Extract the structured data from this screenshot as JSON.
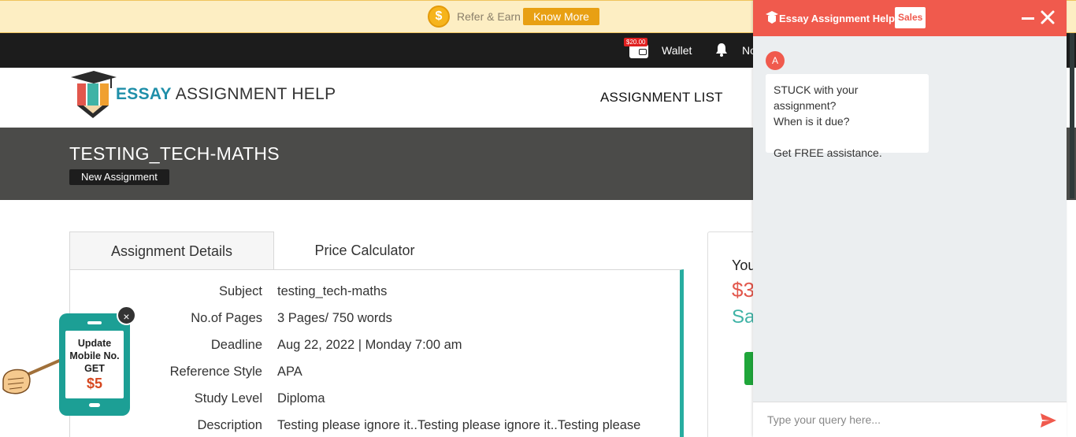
{
  "promo": {
    "coin_symbol": "$",
    "refer_label": "Refer & Earn",
    "know_more_label": "Know More"
  },
  "topbar": {
    "wallet_amount": "$20.00",
    "wallet_label": "Wallet",
    "notifications_label": "No"
  },
  "header": {
    "logo_essay": "ESSAY",
    "logo_rest": " ASSIGNMENT HELP",
    "nav_assignment_list": "ASSIGNMENT LIST"
  },
  "page": {
    "title": "TESTING_TECH-MATHS",
    "status_badge": "New Assignment"
  },
  "tabs": [
    {
      "label": "Assignment Details"
    },
    {
      "label": "Price Calculator"
    }
  ],
  "details": [
    {
      "key": "Subject",
      "value": "testing_tech-maths"
    },
    {
      "key": "No.of Pages",
      "value": "3 Pages/ 750 words"
    },
    {
      "key": "Deadline",
      "value": "Aug 22, 2022 | Monday 7:00 am"
    },
    {
      "key": "Reference Style",
      "value": "APA"
    },
    {
      "key": "Study Level",
      "value": "Diploma"
    },
    {
      "key": "Description",
      "value": "Testing please ignore it..Testing please ignore it..Testing please"
    }
  ],
  "summary": {
    "you_label": "You",
    "price": "$3",
    "save_label": "Sa"
  },
  "chat": {
    "title": "Essay Assignment Help",
    "tag": "Sales",
    "avatar_letter": "A",
    "message_line1": "STUCK with your assignment?",
    "message_line2": "When is it due?",
    "message_line3": "Get FREE assistance.",
    "input_placeholder": "Type your query here..."
  },
  "phone_promo": {
    "line1": "Update",
    "line2": "Mobile No.",
    "line3": "GET",
    "amount": "$5",
    "close_symbol": "×"
  },
  "colors": {
    "accent_red": "#f05a4d",
    "teal": "#27ada0",
    "promo_orange": "#e8a013",
    "brand_blue": "#1f8fa9"
  }
}
